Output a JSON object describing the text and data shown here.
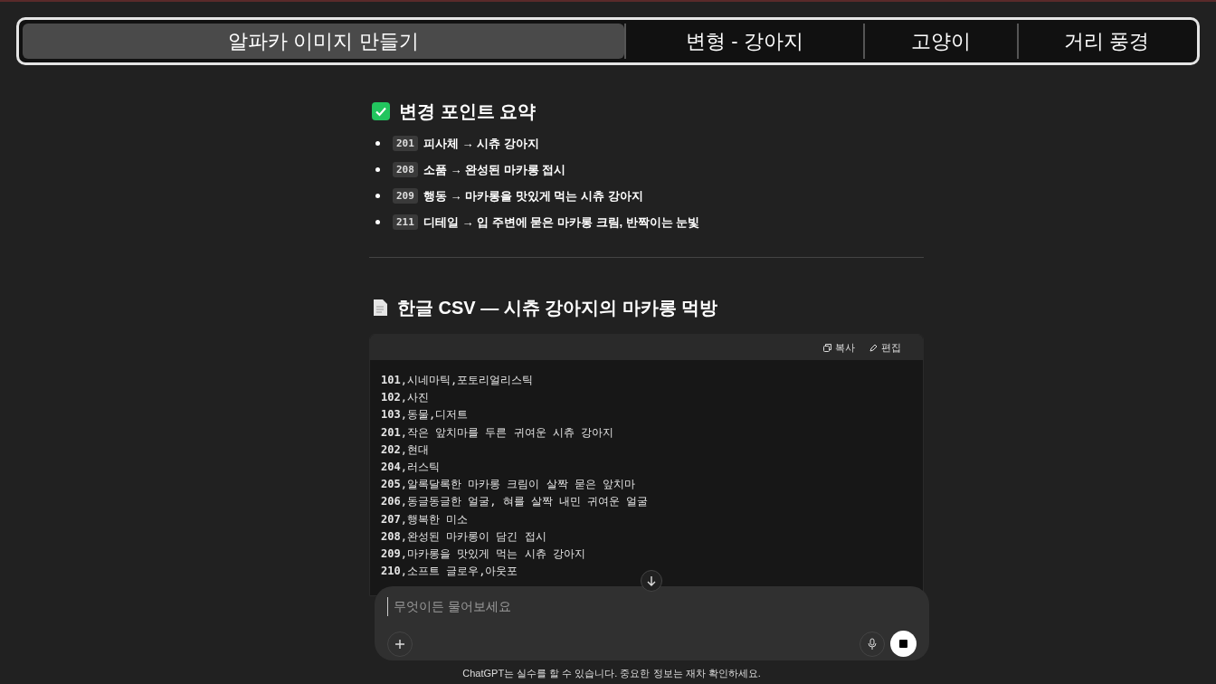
{
  "tabs": [
    {
      "label": "알파카 이미지 만들기",
      "selected": true
    },
    {
      "label": "변형 - 강아지",
      "selected": false
    },
    {
      "label": "고양이",
      "selected": false
    },
    {
      "label": "거리 풍경",
      "selected": false
    }
  ],
  "summary": {
    "title": "변경 포인트 요약",
    "items": [
      {
        "code": "201",
        "text": "피사체 → 시츄 강아지"
      },
      {
        "code": "208",
        "text": "소품 → 완성된 마카롱 접시"
      },
      {
        "code": "209",
        "text": "행동 → 마카롱을 맛있게 먹는 시츄 강아지"
      },
      {
        "code": "211",
        "text": "디테일 → 입 주변에 묻은 마카롱 크림, 반짝이는 눈빛"
      }
    ]
  },
  "csv": {
    "title": "한글 CSV — 시츄 강아지의 마카롱 먹방",
    "copy_label": "복사",
    "edit_label": "편집",
    "lines": [
      "**101**,시네마틱,포토리얼리스틱",
      "**102**,사진",
      "**103**,동물,디저트",
      "**201**,작은 앞치마를 두른 귀여운 시츄 강아지",
      "**202**,현대",
      "**204**,러스틱",
      "**205**,알록달록한 마카롱 크림이 살짝 묻은 앞치마",
      "**206**,동글동글한 얼굴, 혀를 살짝 내민 귀여운 얼굴",
      "**207**,행복한 미소",
      "**208**,완성된 마카롱이 담긴 접시",
      "**209**,마카롱을 맛있게 먹는 시츄 강아지",
      "**210**,소프트 글로우,아웃포"
    ]
  },
  "composer": {
    "placeholder": "무엇이든 물어보세요"
  },
  "footer": "ChatGPT는 실수를 할 수 있습니다. 중요한 정보는 재차 확인하세요."
}
